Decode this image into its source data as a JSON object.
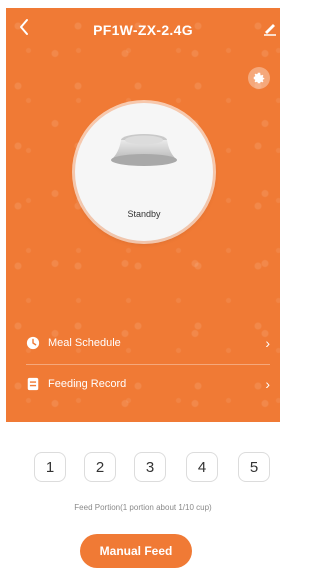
{
  "header": {
    "title": "PF1W-ZX-2.4G",
    "back_icon": "chevron-left-icon",
    "edit_icon": "pencil-icon",
    "settings_icon": "gear-icon"
  },
  "device": {
    "status": "Standby",
    "image": "pet-bowl-image"
  },
  "menu": {
    "items": [
      {
        "label": "Meal Schedule",
        "icon": "clock-icon",
        "chevron": "›"
      },
      {
        "label": "Feeding Record",
        "icon": "document-icon",
        "chevron": "›"
      }
    ]
  },
  "portions": {
    "options": [
      "1",
      "2",
      "3",
      "4",
      "5"
    ],
    "hint": "Feed Portion(1 portion about 1/10 cup)"
  },
  "actions": {
    "manual_feed": "Manual Feed"
  },
  "colors": {
    "accent": "#f07a35",
    "text": "#333333",
    "muted": "#8a8a8a"
  }
}
